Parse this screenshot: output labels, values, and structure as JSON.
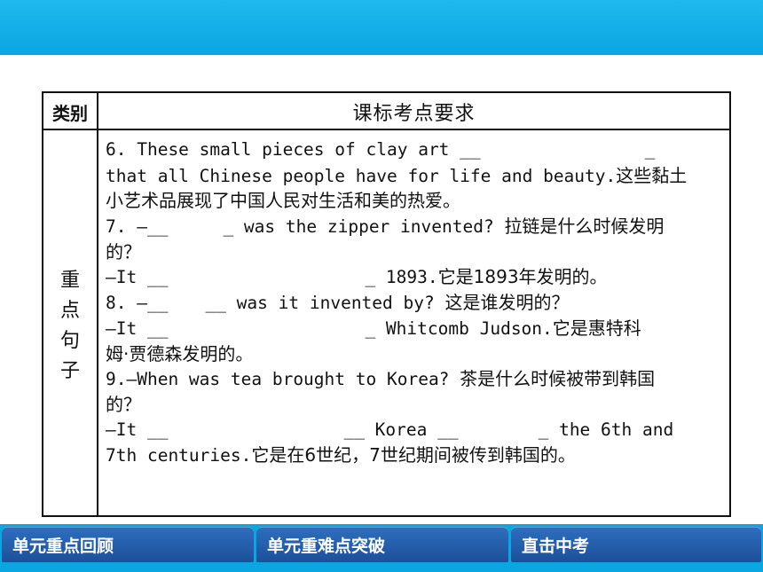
{
  "table": {
    "header_category": "类别",
    "header_requirements": "课标考点要求",
    "row_label_chars": [
      "重",
      "点",
      "句",
      "子"
    ]
  },
  "content": {
    "line1": "6. These small pieces of clay art __",
    "line1_tail": "_",
    "line2": "that all Chinese people have for life and beauty.",
    "line2_cn": "这些黏土",
    "line3_cn": "小艺术品展现了中国人民对生活和美的热爱。",
    "line4_a": "7. —__",
    "line4_b": "_ was the zipper invented? ",
    "line4_cn": "拉链是什么时候发明",
    "line5_cn": "的？",
    "line6_a": "—It __",
    "line6_b": "_ 1893.",
    "line6_cn": "它是1893年发明的。",
    "line7_a": "8. —__",
    "line7_b": "__ was it invented by? ",
    "line7_cn": "这是谁发明的？",
    "line8_a": "—It __",
    "line8_b": "_ Whitcomb Judson.",
    "line8_cn": "它是惠特科",
    "line9_cn": "姆·贾德森发明的。",
    "line10": "9.—When was tea brought to Korea? ",
    "line10_cn": "茶是什么时候被带到韩国",
    "line11_cn": "的？",
    "line12_a": "—It __",
    "line12_b": "__ Korea __",
    "line12_c": "_ the 6th and",
    "line13": "7th centuries.",
    "line13_cn": "它是在6世纪，7世纪期间被传到韩国的。"
  },
  "nav": {
    "btn1": "单元重点回顾",
    "btn2": "单元重难点突破",
    "btn3": "直击中考"
  },
  "colors": {
    "banner": "#0aa6e2",
    "nav_button": "#1d4f9a"
  }
}
